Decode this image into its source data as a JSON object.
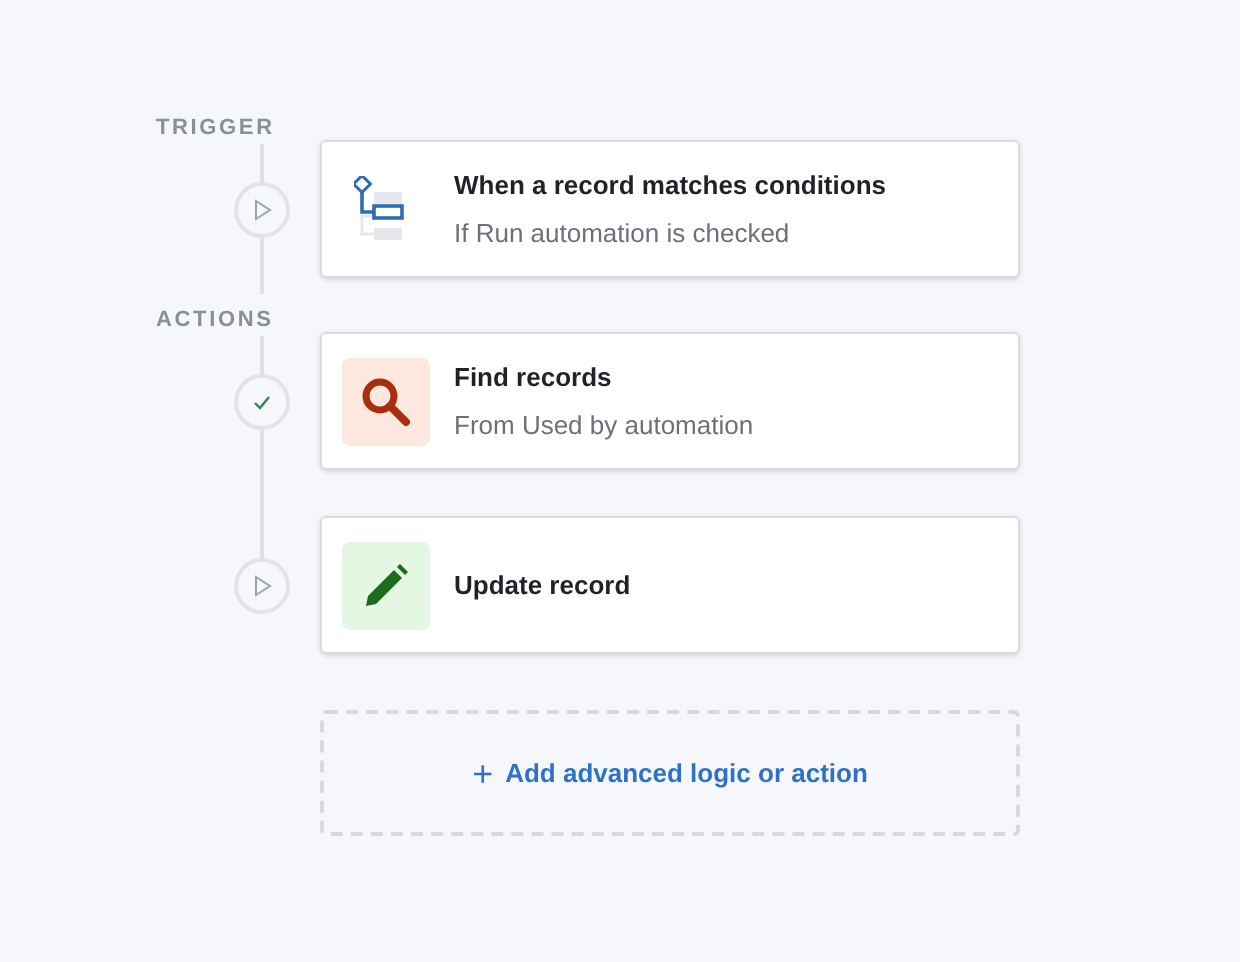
{
  "sections": [
    {
      "label": "TRIGGER",
      "steps": [
        {
          "completed": false,
          "kind": "conditions",
          "title": "When a record matches conditions",
          "subtitle": "If Run automation is checked"
        }
      ]
    },
    {
      "label": "ACTIONS",
      "steps": [
        {
          "completed": true,
          "kind": "search",
          "title": "Find records",
          "subtitle": "From Used by automation"
        },
        {
          "completed": false,
          "kind": "edit",
          "title": "Update record"
        }
      ]
    }
  ],
  "add_button": {
    "icon": "+",
    "label": "Add advanced logic or action"
  }
}
